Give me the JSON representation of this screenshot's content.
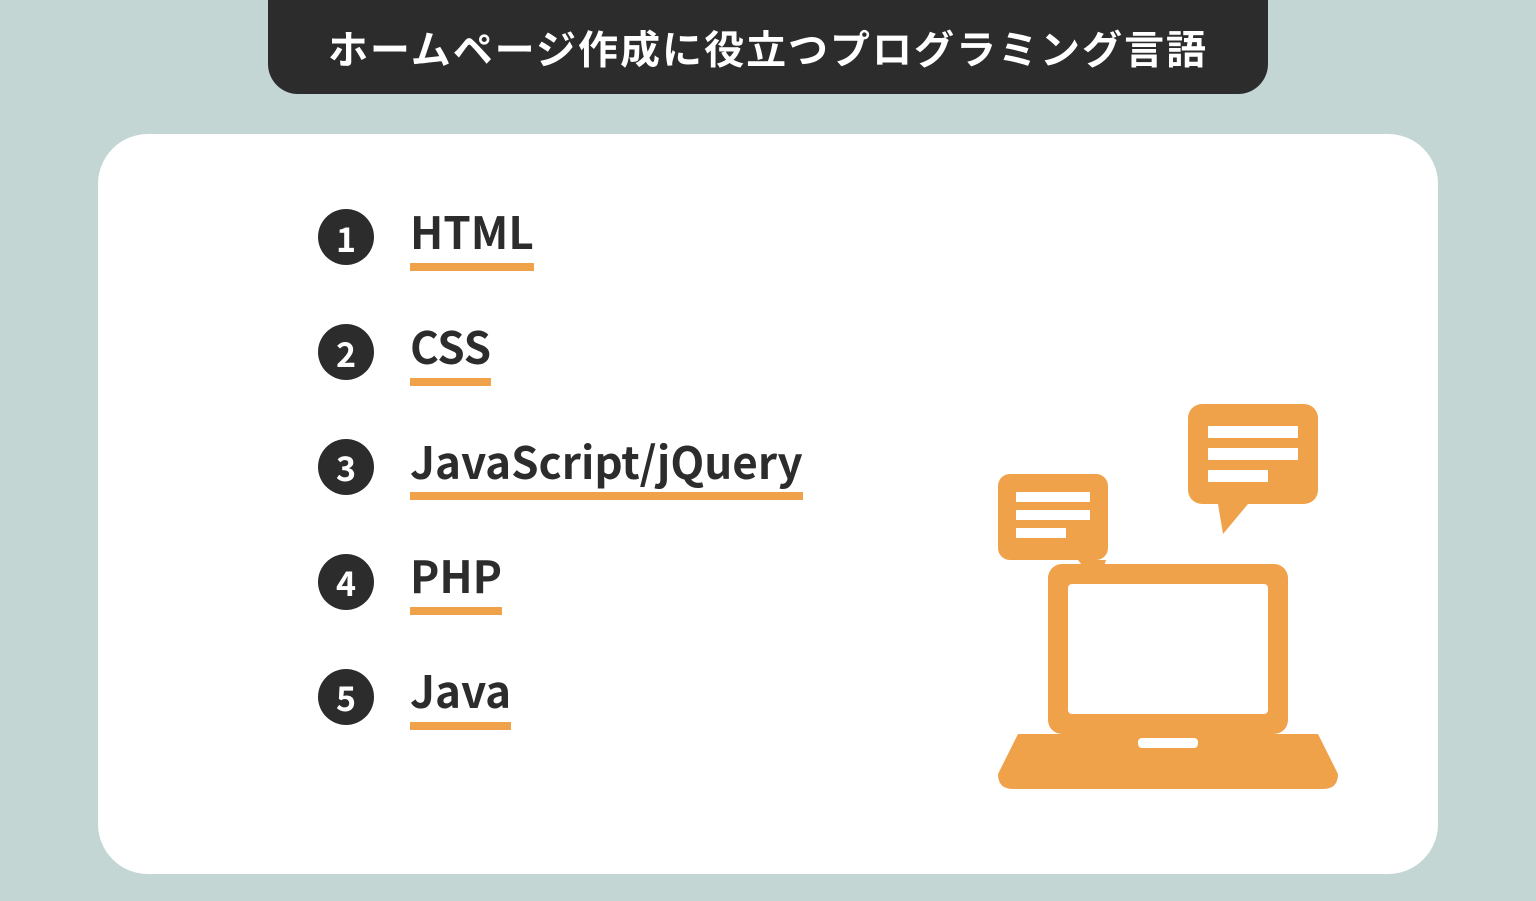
{
  "header": {
    "title": "ホームページ作成に役立つプログラミング言語"
  },
  "list": {
    "items": [
      {
        "num": "1",
        "label": "HTML"
      },
      {
        "num": "2",
        "label": "CSS"
      },
      {
        "num": "3",
        "label": "JavaScript/jQuery"
      },
      {
        "num": "4",
        "label": "PHP"
      },
      {
        "num": "5",
        "label": "Java"
      }
    ]
  },
  "colors": {
    "accent": "#f0a24b",
    "dark": "#2c2c2c",
    "bg": "#c3d6d4"
  }
}
